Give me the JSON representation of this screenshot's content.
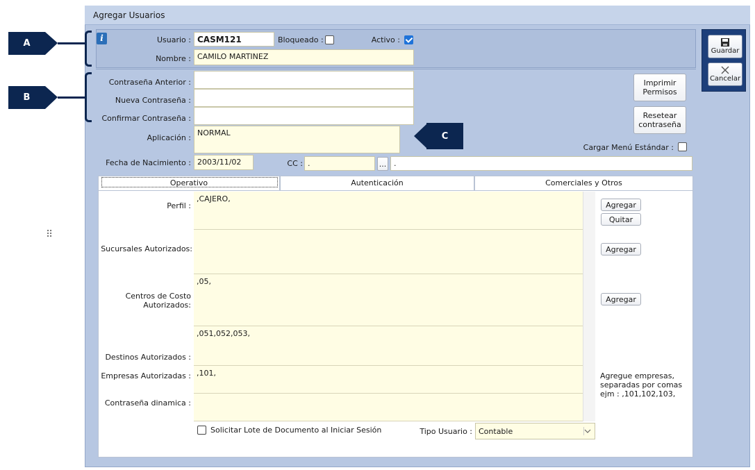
{
  "window": {
    "title": "Agregar Usuarios"
  },
  "user": {
    "usuario_label": "Usuario :",
    "usuario_value": "CASM121",
    "bloqueado_label": "Bloqueado :",
    "activo_label": "Activo :",
    "nombre_label": "Nombre :",
    "nombre_value": "CAMILO MARTINEZ",
    "bloqueado": false,
    "activo": true
  },
  "passwords": {
    "anterior_label": "Contraseña Anterior :",
    "nueva_label": "Nueva Contraseña :",
    "confirmar_label": "Confirmar Contraseña :"
  },
  "app": {
    "aplicacion_label": "Aplicación :",
    "aplicacion_value": "NORMAL",
    "fecha_label": "Fecha de Nacimiento :",
    "fecha_value": "2003/11/02",
    "cc_label": "CC :",
    "cc_value": ".",
    "cc_browse": "...",
    "cc_desc": ".",
    "cargar_menu_label": "Cargar Menú  Estándar :",
    "cargar_menu": false
  },
  "buttons": {
    "imprimir": "Imprimir Permisos",
    "resetear": "Resetear contraseña",
    "guardar": "Guardar",
    "cancelar": "Cancelar"
  },
  "tabs": [
    "Operativo",
    "Autenticación",
    "Comerciales y Otros"
  ],
  "operativo": {
    "perfil_label": "Perfil :",
    "perfil_value": ",CAJERO,",
    "sucursales_label": "Sucursales Autorizados:",
    "sucursales_value": "",
    "centros_label": "Centros de Costo Autorizados:",
    "centros_value": ",05,",
    "destinos_label": "Destinos Autorizados :",
    "destinos_value": ",051,052,053,",
    "empresas_label": "Empresas Autorizadas :",
    "empresas_value": ",101,",
    "dinamica_label": "Contraseña dinamica :",
    "dinamica_value": "",
    "agregar": "Agregar",
    "quitar": "Quitar",
    "hint": "Agregue empresas, separadas por comas ejm : ,101,102,103,",
    "solicitar_label": "Solicitar Lote de Documento al Iniciar Sesión",
    "solicitar": false,
    "tipo_label": "Tipo Usuario :",
    "tipo_value": "Contable"
  },
  "callouts": {
    "a": "A",
    "b": "B",
    "c": "C"
  },
  "icons": {
    "info": "info-icon",
    "save": "floppy-icon",
    "cancel": "close-icon"
  }
}
